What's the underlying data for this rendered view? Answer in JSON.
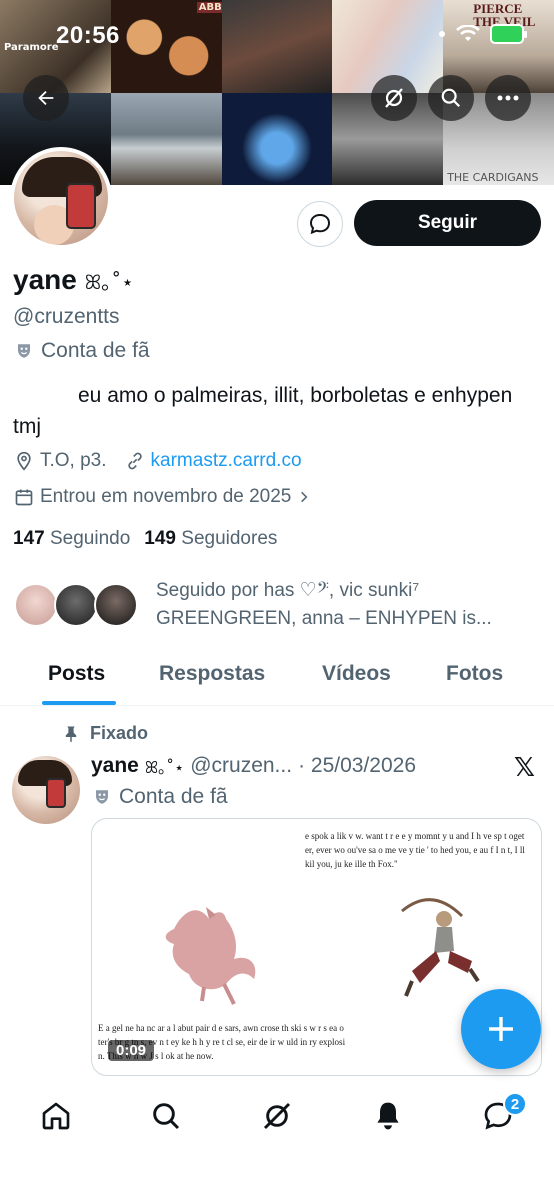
{
  "status_bar": {
    "time": "20:56"
  },
  "banner": {
    "tile_texts": [
      "Paramore",
      "ABBA",
      "PIERCE THE VEIL",
      "THE CARDIGANS"
    ]
  },
  "header_buttons": {
    "back": "back-arrow-icon",
    "grok": "grok-icon",
    "search": "search-icon",
    "more": "more-icon"
  },
  "profile": {
    "name": "yane",
    "name_deco": "ꕤ｡˚⋆",
    "handle": "@cruzentts",
    "fan_label": "Conta de fã",
    "follow_label": "Seguir",
    "bio": "eu amo o palmeiras, illit, borboletas e enhypen tmj",
    "location": "T.O, p3.",
    "link": "karmastz.carrd.co",
    "joined": "Entrou em novembro de 2025",
    "following_count": "147",
    "following_label": "Seguindo",
    "followers_count": "149",
    "followers_label": "Seguidores",
    "followed_by_line1": "Seguido por has ♡𝄢, vic sunki⁷",
    "followed_by_line2": "GREENGREEN, anna – ENHYPEN is..."
  },
  "tabs": [
    "Posts",
    "Respostas",
    "Vídeos",
    "Fotos"
  ],
  "active_tab": "Posts",
  "pinned_post": {
    "pinned_label": "Fixado",
    "author_name": "yane",
    "author_deco": "ꕤ｡˚⋆",
    "author_handle": "@cruzen...",
    "date": "· 25/03/2026",
    "fan_label": "Conta de fã",
    "media_quote_top": "e spok  a      lik  v w.   want t  r    e e y momnt y u and I h ve sp t oget er, ever  wo     ou've sa   o me    ve y tie '     to   hed you,  e au    f I   n t, I ll kil you, ju      ke     ille th Fox.\"",
    "media_quote_bottom": "E  a gel ne ha  nc     ar a l abut  pair   d     e sars,         awn  crose th  ski s   w r s ea   o ter's br g tn s,  ev n t   ey   ke   h      h y  re  t  cl se,   eir de ir  w uld  in      ry explosi n. This w  h w J   s l ok    at he now.",
    "video_time": "0:09"
  },
  "bottom_nav": {
    "items": [
      "home-icon",
      "search-icon",
      "grok-icon",
      "notifications-icon",
      "messages-icon"
    ],
    "messages_badge": "2"
  },
  "colors": {
    "accent": "#1d9bf0",
    "text_primary": "#0f1419",
    "text_secondary": "#536471"
  }
}
